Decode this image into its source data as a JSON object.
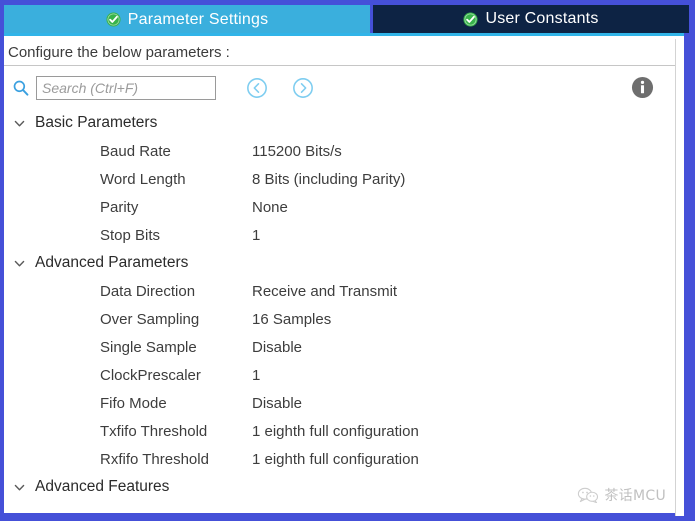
{
  "tabs": [
    {
      "label": "Parameter Settings",
      "icon": "check-circle-icon",
      "active": true
    },
    {
      "label": "User Constants",
      "icon": "check-circle-icon",
      "active": false
    }
  ],
  "configure_bar": {
    "text": "Configure the below parameters :"
  },
  "toolbar": {
    "search_placeholder": "Search (Ctrl+F)",
    "search_value": "",
    "prev_icon": "chevron-left-circle-icon",
    "next_icon": "chevron-right-circle-icon",
    "info_icon": "info-icon",
    "search_icon": "search-icon"
  },
  "groups": [
    {
      "label": "Basic Parameters",
      "expanded": true,
      "params": [
        {
          "name": "Baud Rate",
          "value": "115200 Bits/s"
        },
        {
          "name": "Word Length",
          "value": "8 Bits (including Parity)"
        },
        {
          "name": "Parity",
          "value": "None"
        },
        {
          "name": "Stop Bits",
          "value": "1"
        }
      ]
    },
    {
      "label": "Advanced Parameters",
      "expanded": true,
      "params": [
        {
          "name": "Data Direction",
          "value": "Receive and Transmit"
        },
        {
          "name": "Over Sampling",
          "value": "16 Samples"
        },
        {
          "name": "Single Sample",
          "value": "Disable"
        },
        {
          "name": "ClockPrescaler",
          "value": "1"
        },
        {
          "name": "Fifo Mode",
          "value": "Disable"
        },
        {
          "name": "Txfifo Threshold",
          "value": "1 eighth full configuration"
        },
        {
          "name": "Rxfifo Threshold",
          "value": "1 eighth full configuration"
        }
      ]
    },
    {
      "label": "Advanced Features",
      "expanded": true,
      "params": []
    }
  ],
  "watermark": {
    "text": "茶话MCU",
    "logo": "wechat-bubbles-icon"
  },
  "colors": {
    "window_border": "#4550d8",
    "tab_active_bg": "#3aafdd",
    "tab_inactive_bg": "#0d2344",
    "accent_underline": "#31b4e8",
    "check_green": "#37b34a",
    "icon_blue": "#7ecdf0",
    "info_gray": "#6e6e6e",
    "text": "#3d3d3d"
  }
}
